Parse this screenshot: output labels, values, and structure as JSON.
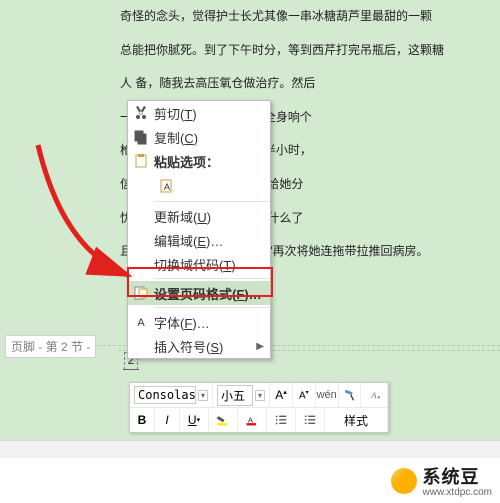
{
  "document": {
    "lines": [
      "奇怪的念头，觉得护士长尤其像一串冰糖葫芦里最甜的一颗",
      "总能把你腻死。到了下午时分，等到西芹打完吊瓶后，这颗糖",
      "人                                             备，随我去高压氧仓做治疗。然后",
      "一                                             有押送\"重犯\"才会用到的全身响个",
      "枪                                             钻进去的\"救生仓\"里闷上半小时，",
      "信                                             有一次当西芹不解地看着给她分",
      "忧                                             西芹终于明白这种好处是什么了",
      "且她会坐在护士长推的\"轮椅\"再次将她连拖带拉推回病房。"
    ]
  },
  "context_menu": {
    "cut": "剪切",
    "cut_k": "T",
    "copy": "复制",
    "copy_k": "C",
    "paste_opts": "粘贴选项：",
    "update": "更新域",
    "update_k": "U",
    "editfield": "编辑域",
    "editfield_k": "E",
    "togglecode": "切换域代码",
    "togglecode_k": "T",
    "pagenum": "设置页码格式",
    "pagenum_k": "F",
    "font": "字体",
    "font_k": "F",
    "symbol": "插入符号",
    "symbol_k": "S"
  },
  "footer": {
    "label": "页脚 - 第 2 节 -",
    "page": "2"
  },
  "mini_toolbar": {
    "font_name": "Consolas",
    "font_size": "小五",
    "wen": "wén",
    "styles": "样式",
    "bold": "B",
    "italic": "I",
    "underline": "U"
  },
  "watermark": {
    "brand": "系统豆",
    "url": "www.xtdpc.com"
  }
}
